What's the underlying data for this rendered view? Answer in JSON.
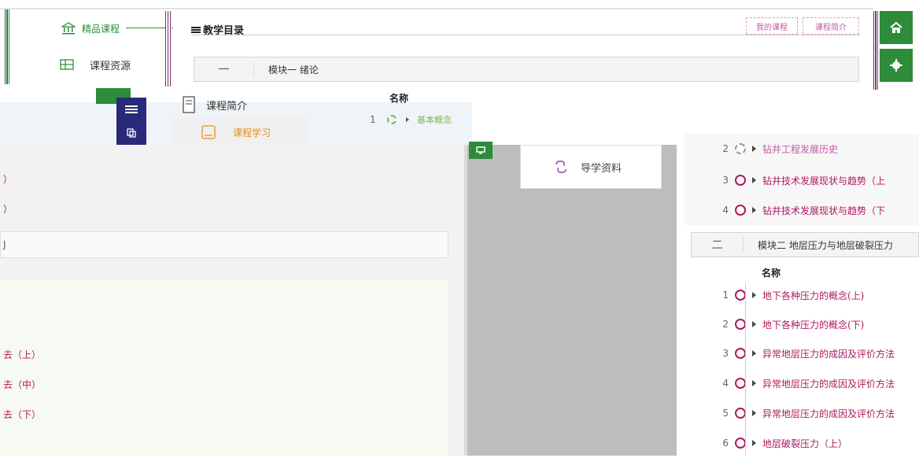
{
  "header": {
    "catalog_title": "教学目录",
    "sidebar_top_label": "精品课程",
    "pill_1": "我的课程",
    "pill_2": "课程简介"
  },
  "side_menu": [
    {
      "label": "课程资源",
      "icon": "grid-icon"
    },
    {
      "label": "课程简介",
      "icon": "document-icon"
    },
    {
      "label": "课程学习",
      "icon": "book-icon"
    },
    {
      "label": "导学资料",
      "icon": "link-icon"
    }
  ],
  "modules": [
    {
      "index": "一",
      "title": "模块一 绪论",
      "col_header": "名称",
      "items": [
        {
          "no": "1",
          "name": "基本概念"
        },
        {
          "no": "2",
          "name": "钻井工程发展历史"
        },
        {
          "no": "3",
          "name": "钻井技术发展现状与趋势（上"
        },
        {
          "no": "4",
          "name": "钻井技术发展现状与趋势（下"
        }
      ]
    },
    {
      "index": "二",
      "title": "模块二 地层压力与地层破裂压力",
      "col_header": "名称",
      "items": [
        {
          "no": "1",
          "name": "地下各种压力的概念(上)"
        },
        {
          "no": "2",
          "name": "地下各种压力的概念(下)"
        },
        {
          "no": "3",
          "name": "异常地层压力的成因及评价方法"
        },
        {
          "no": "4",
          "name": "异常地层压力的成因及评价方法"
        },
        {
          "no": "5",
          "name": "异常地层压力的成因及评价方法"
        },
        {
          "no": "6",
          "name": "地层破裂压力（上）"
        }
      ]
    }
  ],
  "left_fragments": {
    "r1": "）",
    "r2": "）",
    "r3": "J",
    "r4": "去（上）",
    "r5": "去（中）",
    "r6": "去（下）"
  },
  "colors": {
    "accent_magenta": "#b0185c",
    "green": "#2e8b3a",
    "navy": "#2a2a7a",
    "gray_panel": "#bdbdbd"
  }
}
